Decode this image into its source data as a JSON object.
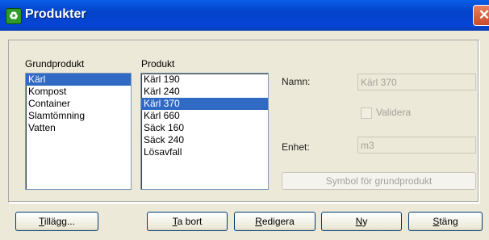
{
  "window": {
    "title": "Produkter"
  },
  "left_list": {
    "label": "Grundprodukt",
    "items": [
      {
        "text": "Kärl",
        "selected": true
      },
      {
        "text": "Kompost",
        "selected": false
      },
      {
        "text": "Container",
        "selected": false
      },
      {
        "text": "Slamtömning",
        "selected": false
      },
      {
        "text": "Vatten",
        "selected": false
      }
    ]
  },
  "right_list": {
    "label": "Produkt",
    "items": [
      {
        "text": "Kärl 190",
        "selected": false
      },
      {
        "text": "Kärl 240",
        "selected": false
      },
      {
        "text": "Kärl 370",
        "selected": true
      },
      {
        "text": "Kärl 660",
        "selected": false
      },
      {
        "text": "Säck 160",
        "selected": false
      },
      {
        "text": "Säck 240",
        "selected": false
      },
      {
        "text": "Lösavfall",
        "selected": false
      }
    ]
  },
  "details": {
    "name_label": "Namn:",
    "name_value": "Kärl 370",
    "validate_label": "Validera",
    "validate_checked": false,
    "unit_label": "Enhet:",
    "unit_value": "m3",
    "symbol_button": "Symbol för grundprodukt"
  },
  "buttons": {
    "add": {
      "first": "T",
      "rest": "illägg..."
    },
    "remove": {
      "first": "T",
      "rest": "a bort"
    },
    "edit": {
      "first": "R",
      "rest": "edigera"
    },
    "new": {
      "first": "N",
      "rest": "y"
    },
    "close": {
      "first": "",
      "mid": "S",
      "pre": "",
      "rest": "täng"
    }
  },
  "colors": {
    "selection": "#316ac5",
    "title_bar": "#0342c9",
    "dialog_bg": "#ece9d8"
  }
}
